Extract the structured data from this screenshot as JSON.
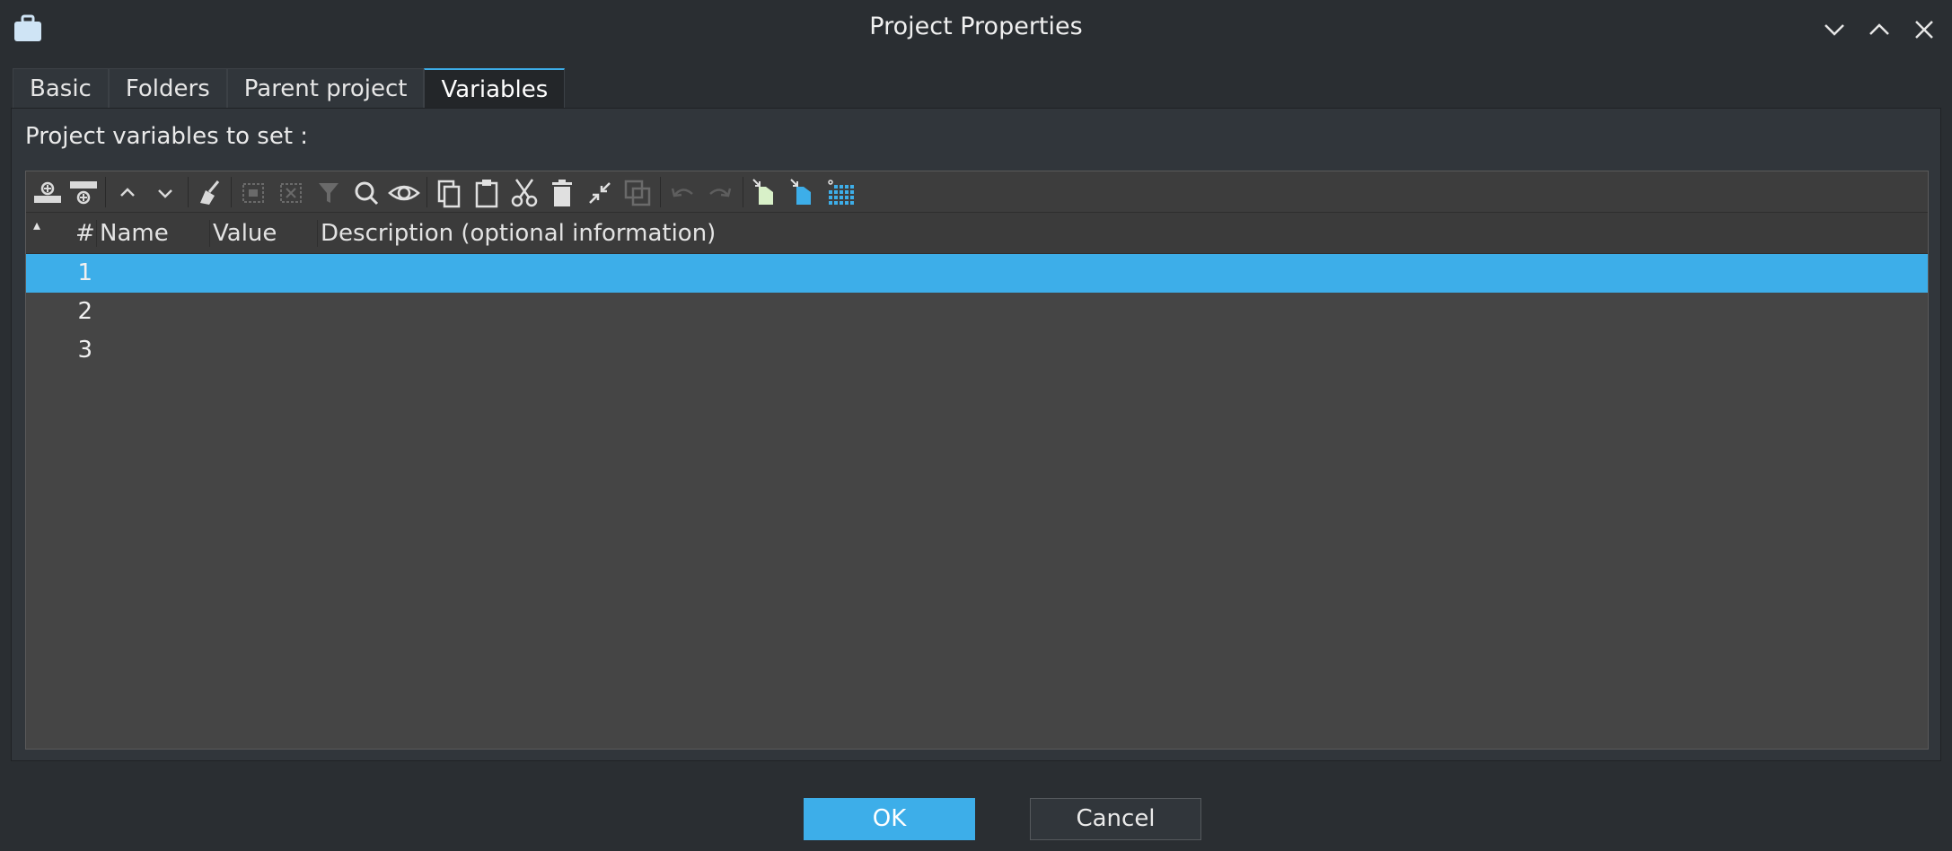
{
  "window": {
    "title": "Project Properties"
  },
  "tabs": [
    {
      "label": "Basic"
    },
    {
      "label": "Folders"
    },
    {
      "label": "Parent project"
    },
    {
      "label": "Variables"
    }
  ],
  "active_tab": "Variables",
  "panel": {
    "section_label": "Project variables to set :"
  },
  "toolbar": {
    "icons": [
      "insert-row-above-icon",
      "insert-row-below-icon",
      "move-up-icon",
      "move-down-icon",
      "clear-icon",
      "select-all-icon",
      "deselect-icon",
      "filter-icon",
      "search-icon",
      "view-icon",
      "copy-icon",
      "paste-icon",
      "cut-icon",
      "delete-icon",
      "collapse-icon",
      "duplicate-icon",
      "undo-icon",
      "redo-icon",
      "import-icon",
      "export-icon",
      "grid-icon"
    ]
  },
  "table": {
    "columns": [
      "#",
      "Name",
      "Value",
      "Description (optional information)"
    ],
    "rows": [
      {
        "num": "1",
        "name": "",
        "value": "",
        "description": ""
      },
      {
        "num": "2",
        "name": "",
        "value": "",
        "description": ""
      },
      {
        "num": "3",
        "name": "",
        "value": "",
        "description": ""
      }
    ],
    "selected_row": 1
  },
  "buttons": {
    "ok": "OK",
    "cancel": "Cancel"
  },
  "colors": {
    "accent": "#3daee9",
    "background": "#2a2e32",
    "panel": "#31363b",
    "grid": "#454545"
  }
}
